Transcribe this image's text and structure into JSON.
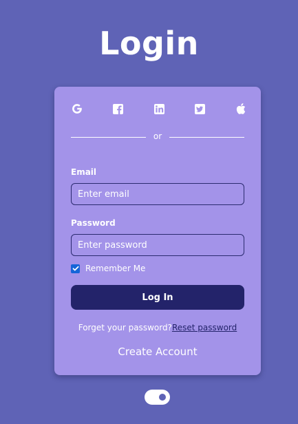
{
  "page": {
    "title": "Login"
  },
  "social": {
    "icons": [
      "google-icon",
      "facebook-icon",
      "linkedin-icon",
      "twitter-icon",
      "apple-icon"
    ]
  },
  "divider": {
    "text": "or"
  },
  "form": {
    "email_label": "Email",
    "email_placeholder": "Enter email",
    "email_value": "",
    "password_label": "Password",
    "password_placeholder": "Enter password",
    "password_value": "",
    "remember_label": "Remember Me",
    "remember_checked": true,
    "login_button": "Log In"
  },
  "links": {
    "forgot_text": "Forget your password?",
    "reset_text": "Reset password",
    "create_account": "Create Account"
  },
  "theme_toggle": {
    "on": true
  },
  "colors": {
    "background": "#5f63b6",
    "card": "#a393e9",
    "button": "#23236a",
    "text": "#ffffff",
    "checkbox": "#1565d8"
  }
}
